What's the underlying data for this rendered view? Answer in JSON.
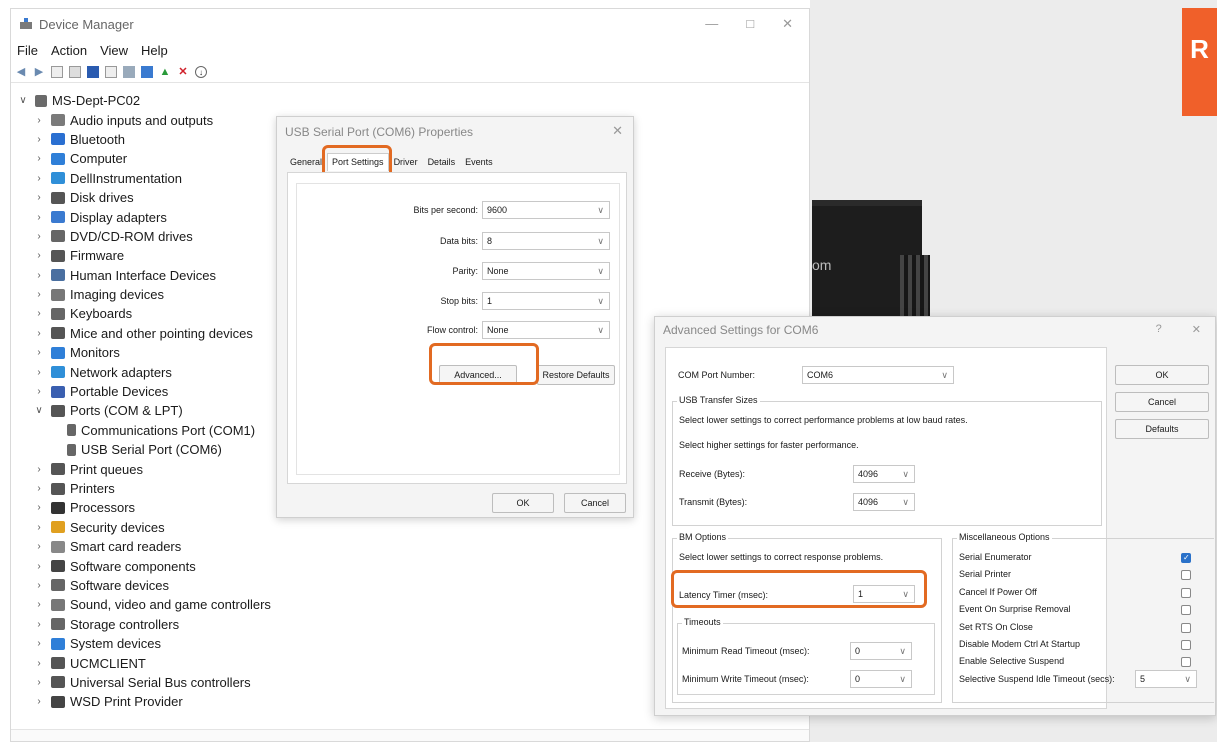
{
  "device_manager": {
    "title": "Device Manager",
    "window_controls": [
      "—",
      "□",
      "✕"
    ],
    "menu": [
      "File",
      "Action",
      "View",
      "Help"
    ],
    "toolbar_icons": [
      "back-arrow-icon",
      "forward-arrow-icon",
      "properties-icon",
      "list-icon",
      "help-icon",
      "view-icon",
      "scan-icon",
      "monitor-icon",
      "update-driver-icon",
      "uninstall-icon",
      "download-icon"
    ],
    "root": "MS-Dept-PC02",
    "tree": [
      {
        "label": "Audio inputs and outputs",
        "icon": "speaker-icon",
        "color": "#7a7a7a"
      },
      {
        "label": "Bluetooth",
        "icon": "bluetooth-icon",
        "color": "#2a6fd1"
      },
      {
        "label": "Computer",
        "icon": "computer-icon",
        "color": "#2f7fd8"
      },
      {
        "label": "DellInstrumentation",
        "icon": "dell-icon",
        "color": "#2f8fd8"
      },
      {
        "label": "Disk drives",
        "icon": "disk-icon",
        "color": "#555555"
      },
      {
        "label": "Display adapters",
        "icon": "display-icon",
        "color": "#3a7ad0"
      },
      {
        "label": "DVD/CD-ROM drives",
        "icon": "dvd-icon",
        "color": "#666666"
      },
      {
        "label": "Firmware",
        "icon": "firmware-icon",
        "color": "#555555"
      },
      {
        "label": "Human Interface Devices",
        "icon": "hid-icon",
        "color": "#4a6fa0"
      },
      {
        "label": "Imaging devices",
        "icon": "camera-icon",
        "color": "#777777"
      },
      {
        "label": "Keyboards",
        "icon": "keyboard-icon",
        "color": "#666666"
      },
      {
        "label": "Mice and other pointing devices",
        "icon": "mouse-icon",
        "color": "#555555"
      },
      {
        "label": "Monitors",
        "icon": "monitor-icon",
        "color": "#2f7fd8"
      },
      {
        "label": "Network adapters",
        "icon": "network-icon",
        "color": "#2f8fd8"
      },
      {
        "label": "Portable Devices",
        "icon": "portable-icon",
        "color": "#3a5fb0"
      },
      {
        "label": "Ports (COM & LPT)",
        "icon": "port-icon",
        "color": "#555555",
        "expanded": true,
        "children": [
          {
            "label": "Communications Port (COM1)",
            "icon": "port-icon"
          },
          {
            "label": "USB Serial Port (COM6)",
            "icon": "port-icon"
          }
        ]
      },
      {
        "label": "Print queues",
        "icon": "printer-icon",
        "color": "#555555"
      },
      {
        "label": "Printers",
        "icon": "printer-icon",
        "color": "#555555"
      },
      {
        "label": "Processors",
        "icon": "processor-icon",
        "color": "#333333"
      },
      {
        "label": "Security devices",
        "icon": "security-icon",
        "color": "#e0a020"
      },
      {
        "label": "Smart card readers",
        "icon": "smartcard-icon",
        "color": "#888888"
      },
      {
        "label": "Software components",
        "icon": "software-component-icon",
        "color": "#444444"
      },
      {
        "label": "Software devices",
        "icon": "software-device-icon",
        "color": "#666666"
      },
      {
        "label": "Sound, video and game controllers",
        "icon": "sound-icon",
        "color": "#777777"
      },
      {
        "label": "Storage controllers",
        "icon": "storage-icon",
        "color": "#666666"
      },
      {
        "label": "System devices",
        "icon": "system-icon",
        "color": "#2f7fd8"
      },
      {
        "label": "UCMCLIENT",
        "icon": "ucm-icon",
        "color": "#555555"
      },
      {
        "label": "Universal Serial Bus controllers",
        "icon": "usb-icon",
        "color": "#555555"
      },
      {
        "label": "WSD Print Provider",
        "icon": "wsd-icon",
        "color": "#444444"
      }
    ]
  },
  "properties_dialog": {
    "title": "USB Serial Port (COM6) Properties",
    "close": "✕",
    "tabs": [
      "General",
      "Port Settings",
      "Driver",
      "Details",
      "Events"
    ],
    "active_tab": "Port Settings",
    "fields": [
      {
        "label": "Bits per second:",
        "value": "9600"
      },
      {
        "label": "Data bits:",
        "value": "8"
      },
      {
        "label": "Parity:",
        "value": "None"
      },
      {
        "label": "Stop bits:",
        "value": "1"
      },
      {
        "label": "Flow control:",
        "value": "None"
      }
    ],
    "advanced_button": "Advanced...",
    "restore_button": "Restore Defaults",
    "ok_button": "OK",
    "cancel_button": "Cancel",
    "highlight_color": "#e26a22"
  },
  "advanced_dialog": {
    "title": "Advanced Settings for COM6",
    "controls": [
      "?",
      "✕"
    ],
    "com_port_label": "COM Port Number:",
    "com_port_value": "COM6",
    "usb_transfer": {
      "title": "USB Transfer Sizes",
      "note1": "Select lower settings to correct performance problems at low baud rates.",
      "note2": "Select higher settings for faster performance.",
      "receive_label": "Receive (Bytes):",
      "receive_value": "4096",
      "transmit_label": "Transmit (Bytes):",
      "transmit_value": "4096"
    },
    "bm_options": {
      "title": "BM Options",
      "note": "Select lower settings to correct response problems.",
      "latency_label": "Latency Timer (msec):",
      "latency_value": "1"
    },
    "timeouts": {
      "title": "Timeouts",
      "read_label": "Minimum Read Timeout (msec):",
      "read_value": "0",
      "write_label": "Minimum Write Timeout (msec):",
      "write_value": "0"
    },
    "misc": {
      "title": "Miscellaneous Options",
      "options": [
        {
          "label": "Serial Enumerator",
          "checked": true
        },
        {
          "label": "Serial Printer",
          "checked": false
        },
        {
          "label": "Cancel If Power Off",
          "checked": false
        },
        {
          "label": "Event On Surprise Removal",
          "checked": false
        },
        {
          "label": "Set RTS On Close",
          "checked": false
        },
        {
          "label": "Disable Modem Ctrl At Startup",
          "checked": false
        },
        {
          "label": "Enable Selective Suspend",
          "checked": false
        }
      ],
      "idle_label": "Selective Suspend Idle Timeout (secs):",
      "idle_value": "5"
    },
    "ok_button": "OK",
    "cancel_button": "Cancel",
    "defaults_button": "Defaults"
  },
  "background": {
    "accent_color": "#f0602a",
    "tab_glyph": "R",
    "device_logo": "om"
  }
}
